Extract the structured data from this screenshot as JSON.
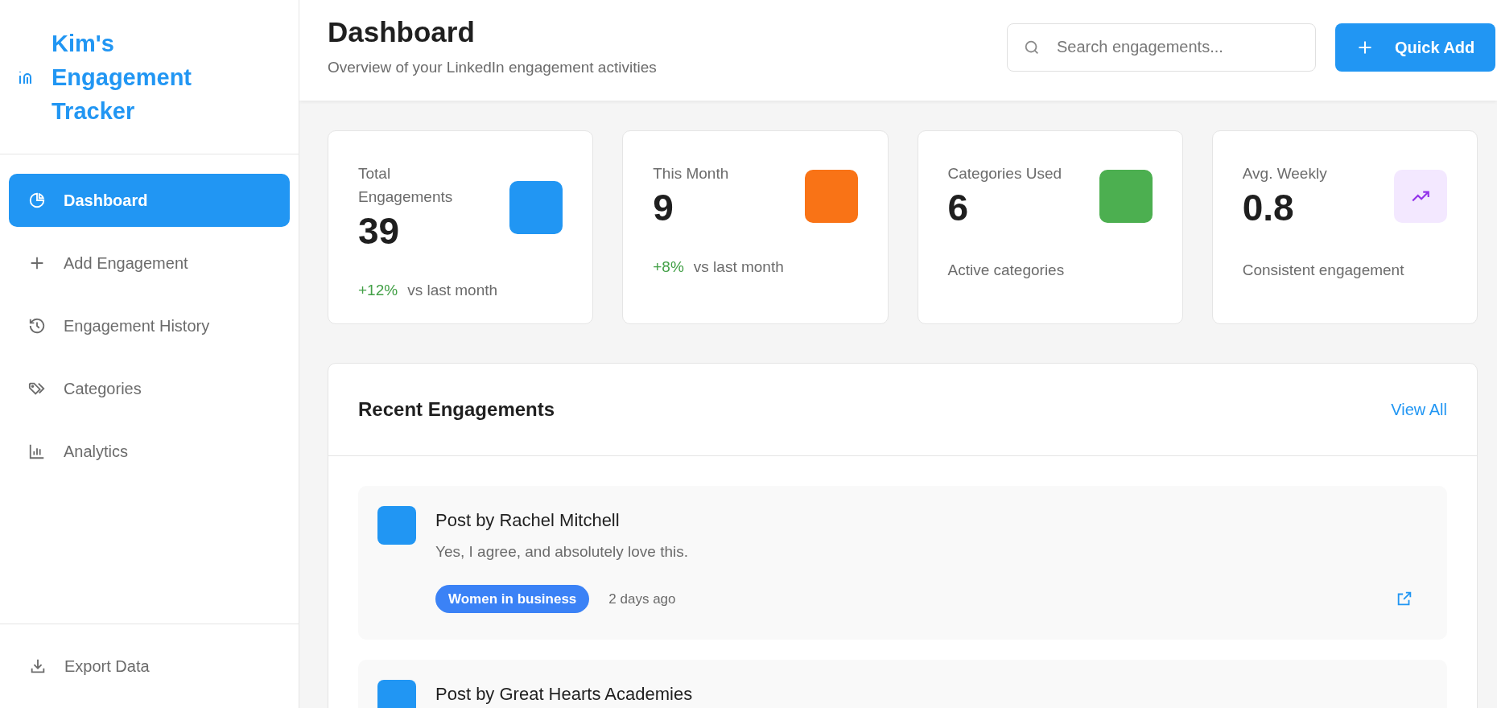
{
  "sidebar": {
    "logo_title": "Kim's Engagement Tracker",
    "items": [
      {
        "label": "Dashboard",
        "selected": true
      },
      {
        "label": "Add Engagement",
        "selected": false
      },
      {
        "label": "Engagement History",
        "selected": false
      },
      {
        "label": "Categories",
        "selected": false
      },
      {
        "label": "Analytics",
        "selected": false
      }
    ],
    "footer_item": {
      "label": "Export Data"
    }
  },
  "header": {
    "title": "Dashboard",
    "subtitle": "Overview of your LinkedIn engagement activities",
    "search": {
      "placeholder": "Search engagements..."
    },
    "quick_add": "Quick Add"
  },
  "stats": [
    {
      "label": "Total Engagements",
      "value": "39",
      "change": "+12%",
      "note": "vs last month",
      "color": "#2196f3"
    },
    {
      "label": "This Month",
      "value": "9",
      "change": "+8%",
      "note": "vs last month",
      "color": "#f97316"
    },
    {
      "label": "Categories Used",
      "value": "6",
      "note": "Active categories",
      "color": "#4caf50"
    },
    {
      "label": "Avg. Weekly",
      "value": "0.8",
      "note": "Consistent engagement",
      "color": "#f3e8ff"
    }
  ],
  "recent": {
    "title": "Recent Engagements",
    "view_all": "View All",
    "items": [
      {
        "title": "Post by Rachel Mitchell",
        "text": "Yes, I agree, and absolutely love this.",
        "tag": "Women in business",
        "time": "2 days ago"
      },
      {
        "title": "Post by Great Hearts Academies"
      }
    ]
  }
}
